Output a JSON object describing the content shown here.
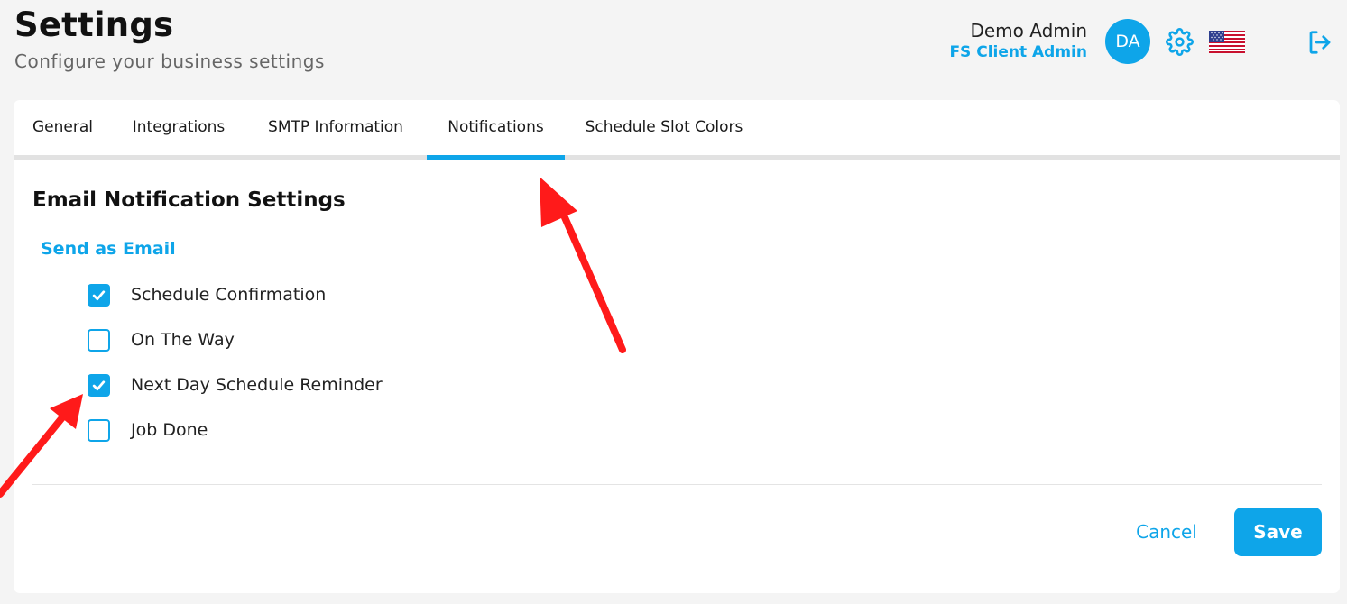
{
  "header": {
    "title": "Settings",
    "subtitle": "Configure your business settings",
    "user_name": "Demo Admin",
    "user_role": "FS Client Admin",
    "avatar_initials": "DA",
    "icons": [
      "gear-icon",
      "us-flag-icon",
      "logout-icon"
    ]
  },
  "tabs": [
    {
      "label": "General",
      "active": false
    },
    {
      "label": "Integrations",
      "active": false
    },
    {
      "label": "SMTP Information",
      "active": false
    },
    {
      "label": "Notifications",
      "active": true
    },
    {
      "label": "Schedule Slot Colors",
      "active": false
    }
  ],
  "notifications": {
    "section_title": "Email Notification Settings",
    "group_label": "Send as Email",
    "options": [
      {
        "label": "Schedule Confirmation",
        "checked": true
      },
      {
        "label": "On The Way",
        "checked": false
      },
      {
        "label": "Next Day Schedule Reminder",
        "checked": true
      },
      {
        "label": "Job Done",
        "checked": false
      }
    ]
  },
  "actions": {
    "cancel_label": "Cancel",
    "save_label": "Save"
  },
  "colors": {
    "accent": "#0ea5e9",
    "annotation_arrow": "#ff1a1a"
  }
}
